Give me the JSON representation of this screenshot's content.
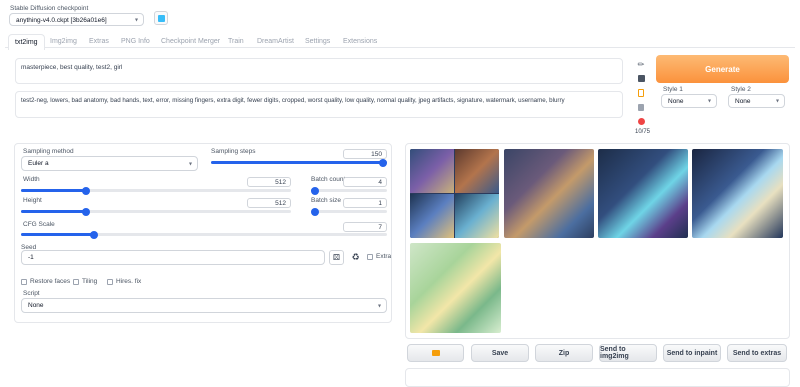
{
  "checkpoint": {
    "label": "Stable Diffusion checkpoint",
    "value": "anything-v4.0.ckpt [3b26a01e6]"
  },
  "tabs": [
    "txt2img",
    "Img2img",
    "Extras",
    "PNG Info",
    "Checkpoint Merger",
    "Train",
    "DreamArtist",
    "Settings",
    "Extensions"
  ],
  "prompt": "masterpiece, best quality, test2, girl",
  "negative_prompt": "test2-neg, lowers, bad anatomy, bad hands, text, error, missing fingers, extra digit, fewer digits, cropped, worst quality, low quality, normal quality, jpeg artifacts, signature, watermark, username, blurry",
  "token_count": "10/75",
  "generate_label": "Generate",
  "style1": {
    "label": "Style 1",
    "value": "None"
  },
  "style2": {
    "label": "Style 2",
    "value": "None"
  },
  "sampling_method": {
    "label": "Sampling method",
    "value": "Euler a"
  },
  "sampling_steps": {
    "label": "Sampling steps",
    "value": "150",
    "fraction": 1.0
  },
  "width": {
    "label": "Width",
    "value": "512",
    "fraction": 0.24
  },
  "height": {
    "label": "Height",
    "value": "512",
    "fraction": 0.24
  },
  "batch_count": {
    "label": "Batch count",
    "value": "4",
    "fraction": 0.04
  },
  "batch_size": {
    "label": "Batch size",
    "value": "1",
    "fraction": 0.0
  },
  "cfg_scale": {
    "label": "CFG Scale",
    "value": "7",
    "fraction": 0.2
  },
  "seed": {
    "label": "Seed",
    "value": "-1",
    "extra_label": "Extra"
  },
  "options": {
    "restore_faces": "Restore faces",
    "tiling": "Tiling",
    "hires_fix": "Hires. fix"
  },
  "script": {
    "label": "Script",
    "value": "None"
  },
  "actions": {
    "save": "Save",
    "zip": "Zip",
    "img2img": "Send to img2img",
    "inpaint": "Send to inpaint",
    "extras": "Send to extras"
  },
  "colors": {
    "accent": "#2563eb",
    "generate_from": "#fdba74",
    "generate_to": "#fb923c"
  }
}
